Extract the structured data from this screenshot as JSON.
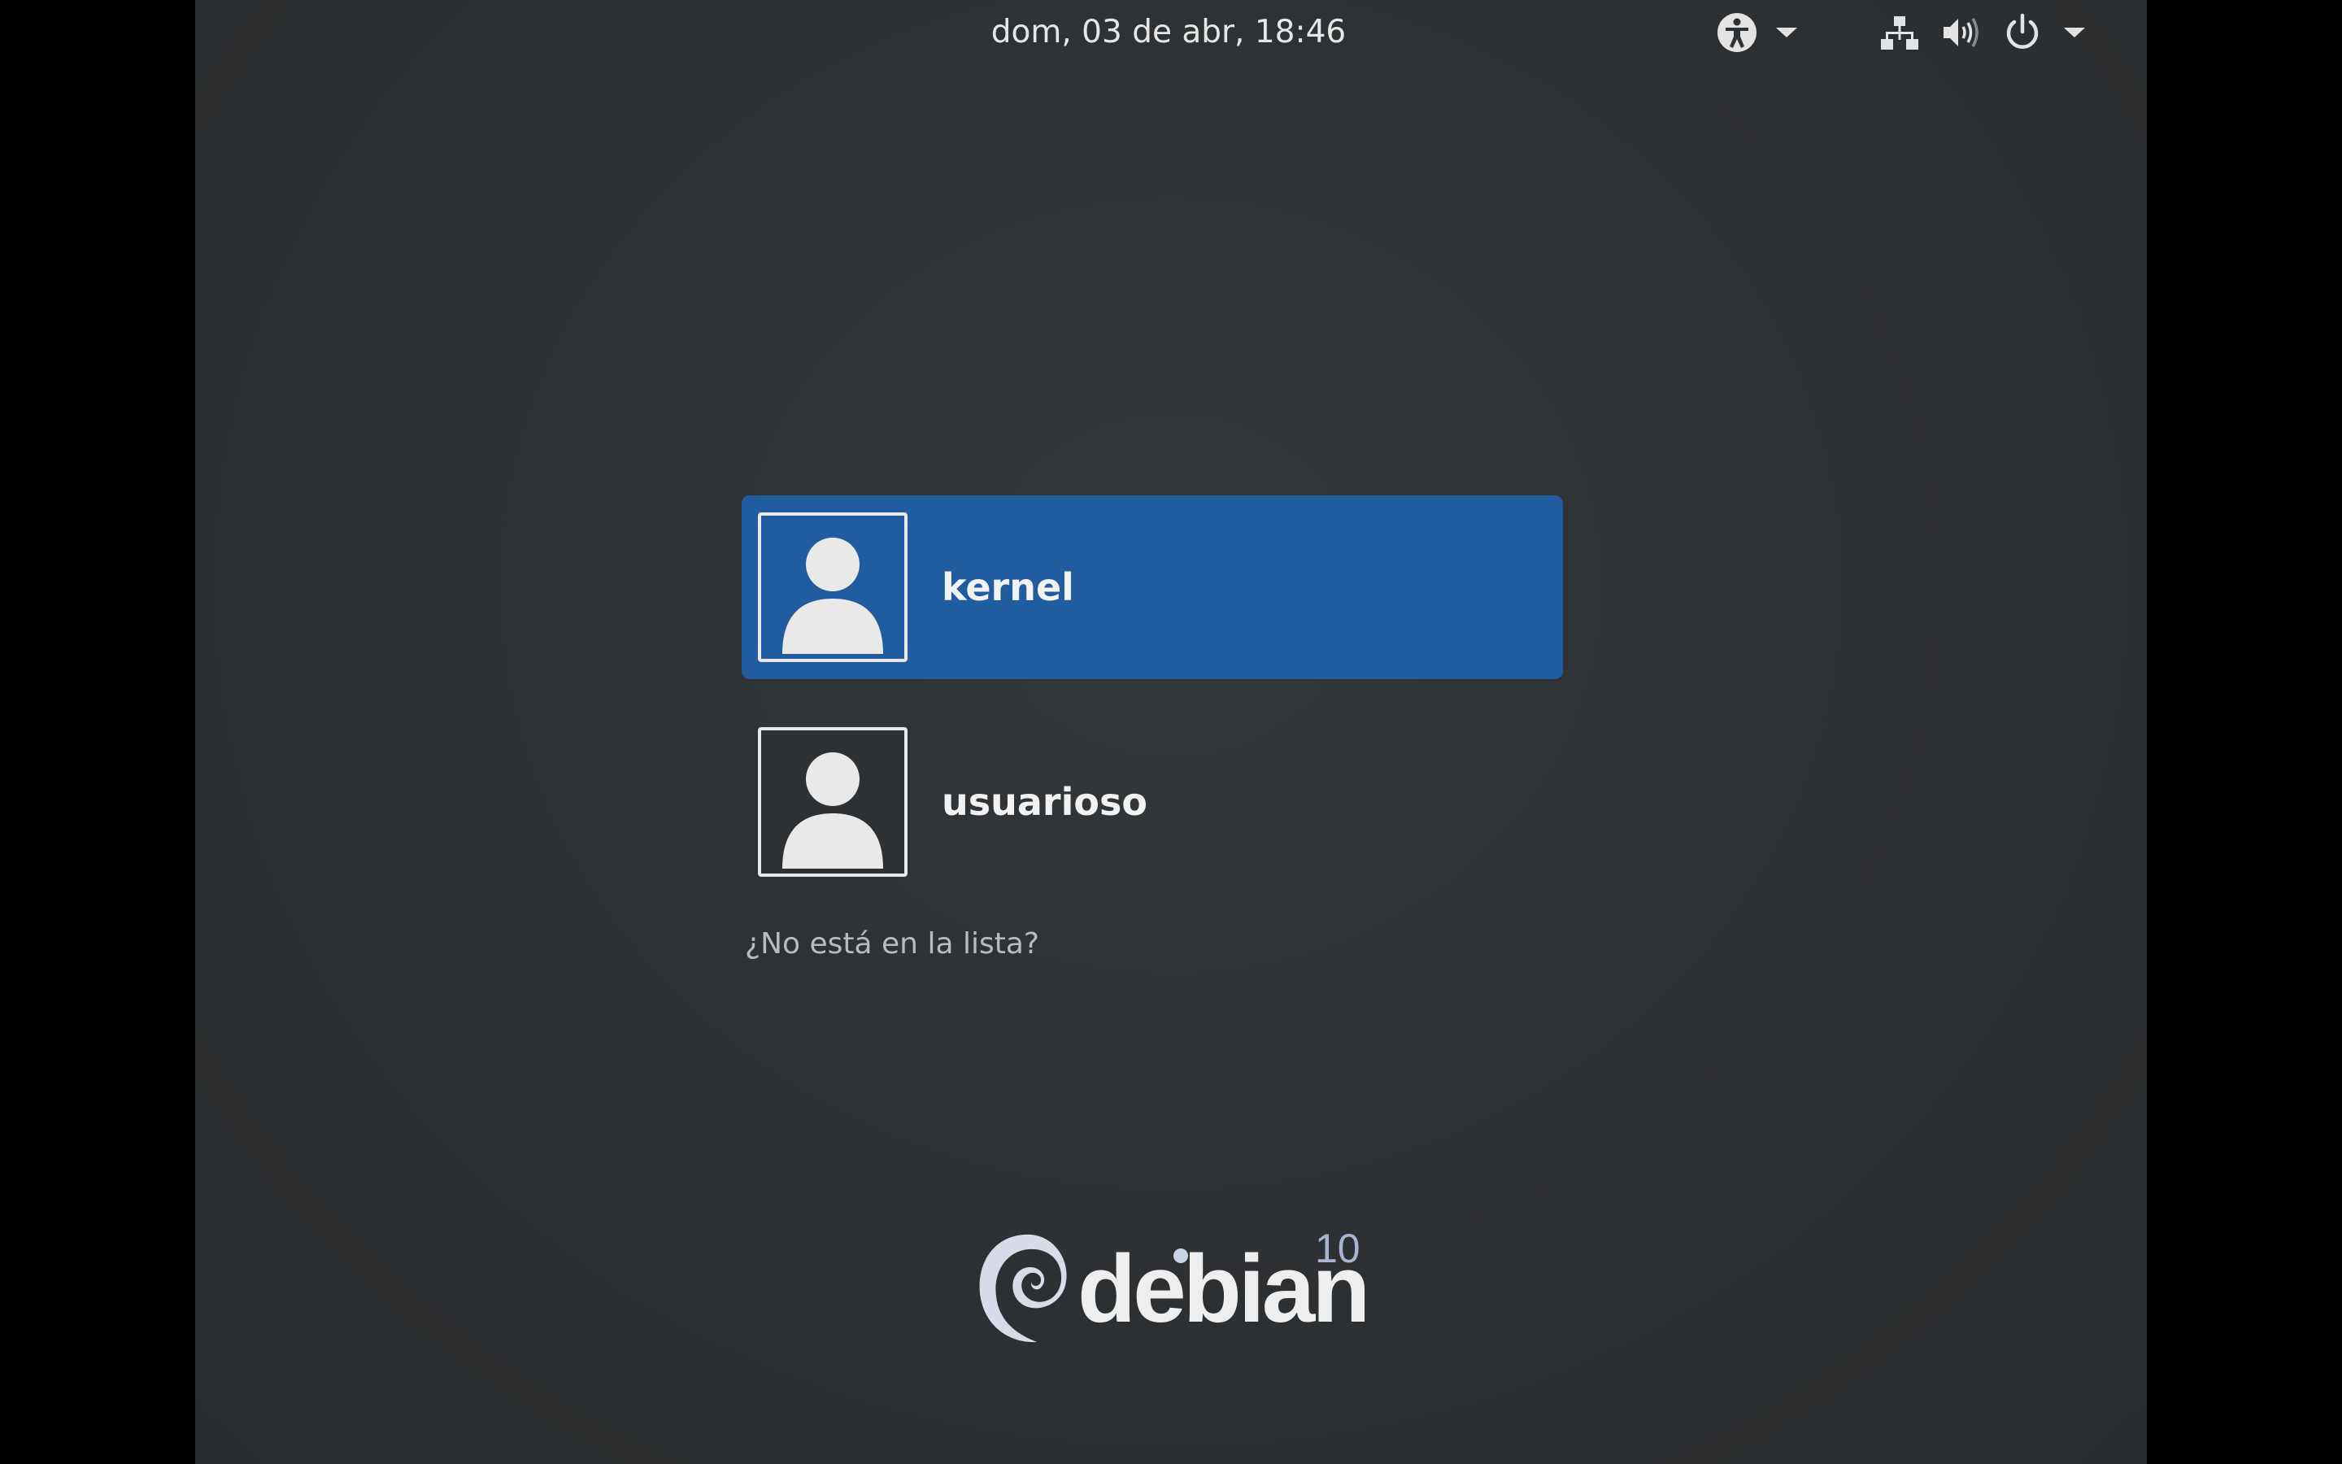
{
  "topbar": {
    "datetime": "dom, 03 de abr, 18:46",
    "icons": [
      "accessibility-icon",
      "network-icon",
      "volume-icon",
      "power-icon"
    ]
  },
  "users": [
    {
      "name": "kernel",
      "selected": true
    },
    {
      "name": "usuarioso",
      "selected": false
    }
  ],
  "not_listed_label": "¿No está en la lista?",
  "logo": {
    "word": "debian",
    "version": "10"
  },
  "colors": {
    "background": "#2e3133",
    "selection": "#215ca1",
    "text": "#f2f2f2",
    "muted_text": "#b8bcbd"
  }
}
